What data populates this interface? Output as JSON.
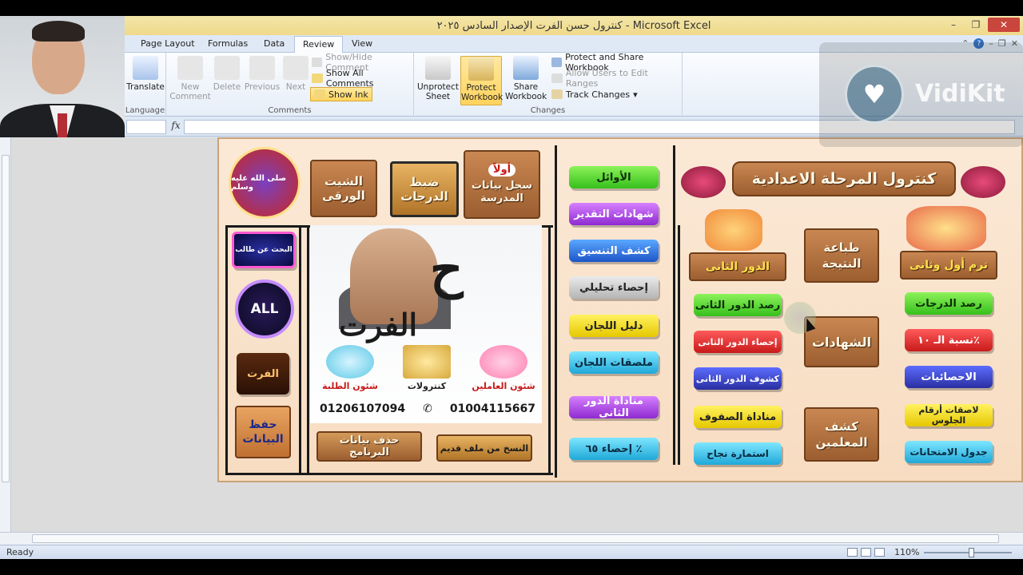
{
  "window": {
    "title": "كنترول حسن الفرت الإصدار السادس ٢٠٢٥ - Microsoft Excel"
  },
  "tabs": [
    "Page Layout",
    "Formulas",
    "Data",
    "Review",
    "View"
  ],
  "active_tab": "Review",
  "ribbon": {
    "language": {
      "translate": "Translate",
      "group_label": "Language"
    },
    "comments": {
      "new_comment": "New Comment",
      "delete": "Delete",
      "previous": "Previous",
      "next": "Next",
      "show_hide_comment": "Show/Hide Comment",
      "show_all_comments": "Show All Comments",
      "show_ink": "Show Ink",
      "group_label": "Comments"
    },
    "changes": {
      "unprotect_sheet": "Unprotect Sheet",
      "protect_workbook": "Protect Workbook",
      "share_workbook": "Share Workbook",
      "protect_share_workbook": "Protect and Share Workbook",
      "allow_users_edit_ranges": "Allow Users to Edit Ranges",
      "track_changes": "Track Changes",
      "group_label": "Changes"
    }
  },
  "formula_bar": {
    "fx_label": "fx",
    "value": ""
  },
  "watermark": {
    "brand": "VidiKit"
  },
  "dashboard": {
    "top_left_seal": "صلى الله عليه وسلم",
    "sheet_paper": "الشيت الورقى",
    "grading": "ضبط الدرجات",
    "first_label": "أولاً",
    "school_data": "سجل بيانات المدرسة",
    "search_student": "البحث عن طالب",
    "all": "ALL",
    "logo_text": "الفرت",
    "save_data": "حفظ البيانات",
    "poster": {
      "name": "الفرت",
      "icon1": "شئون الطلبة",
      "icon2": "كنترولات",
      "icon3": "شئون العاملين",
      "phone1": "01206107094",
      "phone2": "01004115667"
    },
    "delete_program_data": "حذف بيانات البرنامج",
    "copy_old_file": "النسخ من ملف قديم",
    "middle_pills": [
      "الأوائل",
      "شهادات التقدير",
      "كشف التنسيق",
      "إحصاء تحليلي",
      "دليل اللجان",
      "ملصقات اللجان",
      "مناداة الدور الثانى",
      "إحصاء ٦٥ ٪"
    ],
    "banner": "كنترول المرحلة الاعدادية",
    "second_round": "الدور الثانى",
    "print_result": "طباعة النتيجة",
    "first_second_term": "ترم أول وثانى",
    "certificates": "الشهادات",
    "teachers_list": "كشف المعلمين",
    "left_pills": [
      "رصد الدور الثانى",
      "إحصاء الدور الثانى",
      "كشوف الدور الثانى",
      "مناداة الصفوف",
      "استمارة نجاح"
    ],
    "right_pills": [
      "رصد الدرجات",
      "نسبة الـ ١٠٪",
      "الاحصائيات",
      "لاصقات أرقام الجلوس",
      "جدول الامتحانات"
    ]
  },
  "status": {
    "ready": "Ready",
    "zoom": "110%"
  }
}
